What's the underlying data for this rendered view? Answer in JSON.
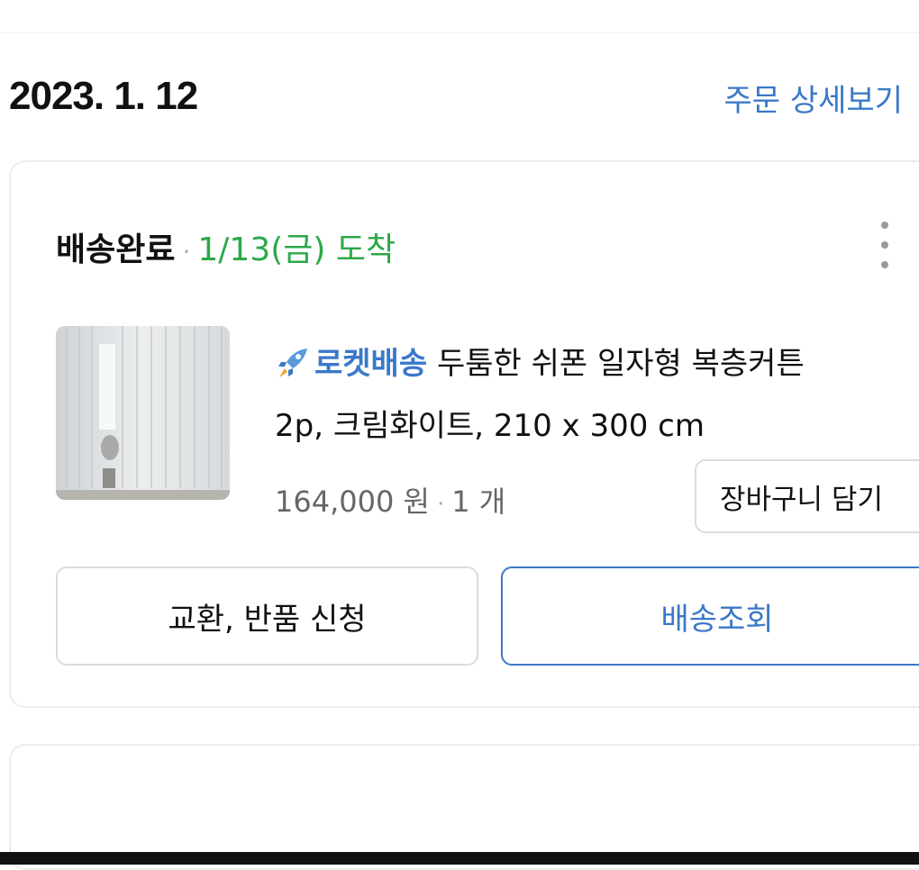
{
  "order": {
    "date": "2023. 1. 12",
    "detail_link": "주문 상세보기"
  },
  "shipment": {
    "status": "배송완료",
    "separator": "·",
    "arrival": "1/13(금) 도착",
    "status_color": "#2ca84a"
  },
  "product": {
    "badge": "로켓배송",
    "badge_icon": "rocket-icon",
    "title_line1": "두툼한 쉬폰 일자형 복층커튼",
    "title_line2": "2p, 크림화이트, 210 x 300 cm",
    "price": "164,000 원",
    "separator": "·",
    "quantity": "1 개",
    "thumbnail": "curtain-thumbnail"
  },
  "actions": {
    "add_to_cart": "장바구니 담기",
    "exchange_return": "교환, 반품 신청",
    "track_delivery": "배송조회",
    "more_icon": "more-vertical-icon"
  },
  "colors": {
    "accent_blue": "#3a78c8",
    "delivered_green": "#2ca84a"
  }
}
